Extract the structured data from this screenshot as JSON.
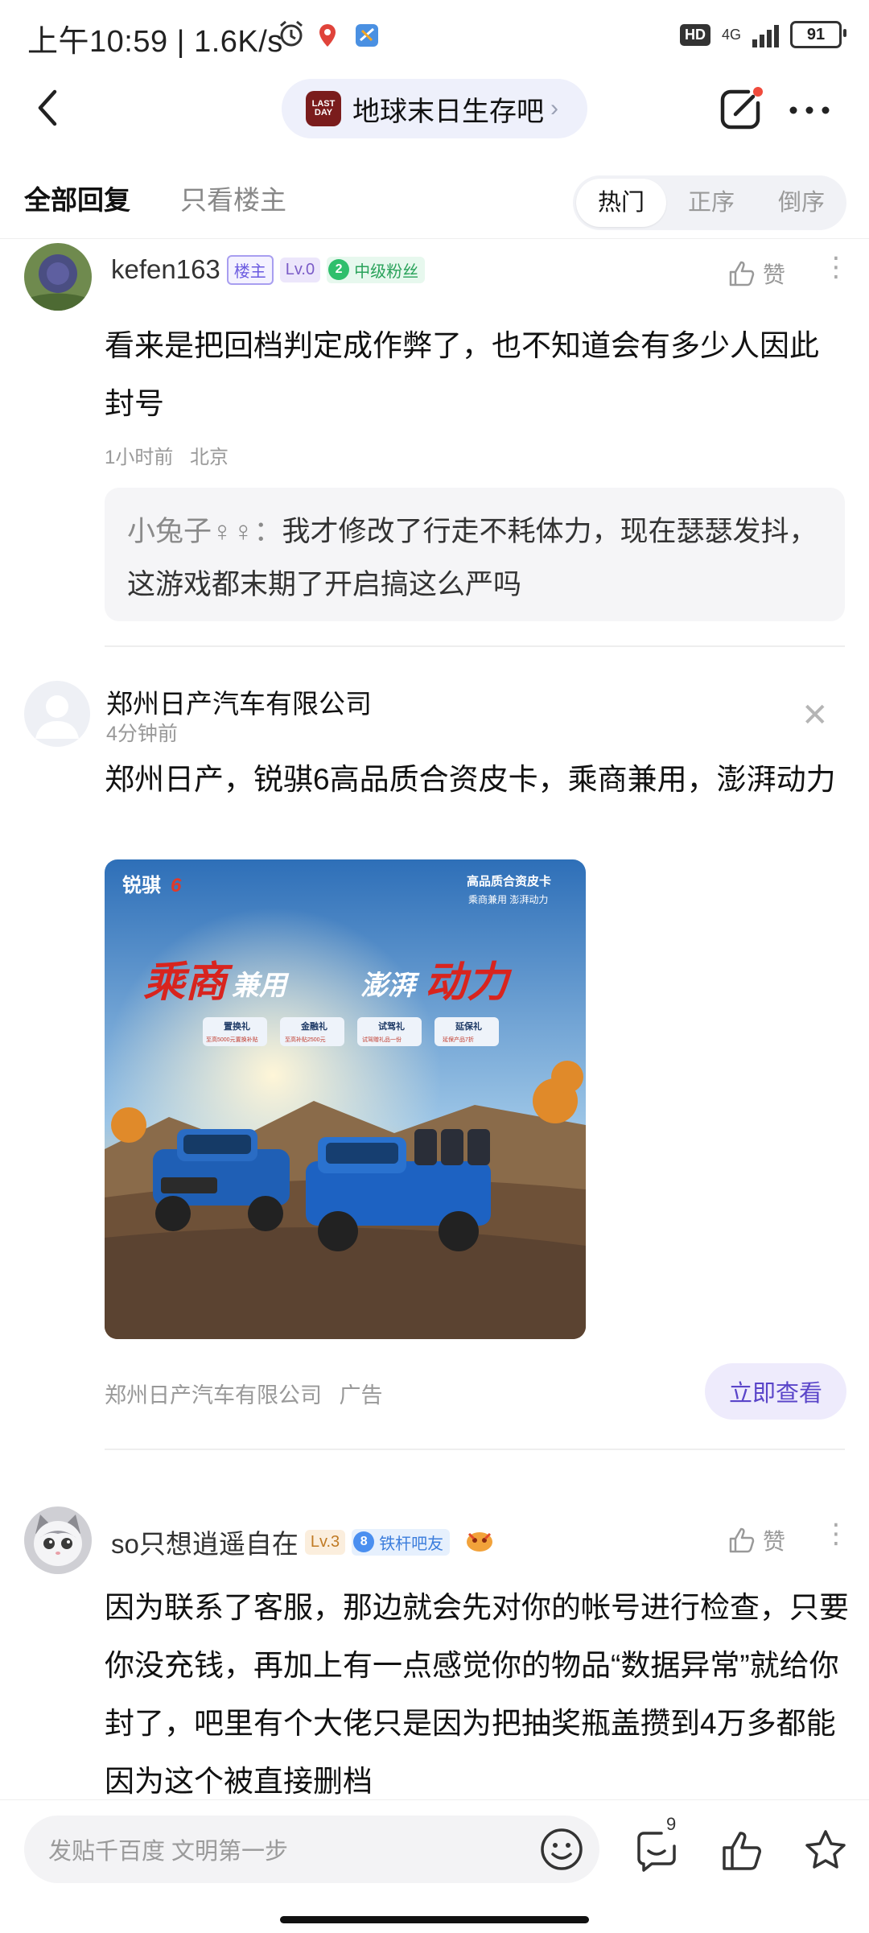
{
  "status_bar": {
    "time": "上午10:59 | 1.6K/s",
    "hd": "HD",
    "network": "4G",
    "battery": "91"
  },
  "nav": {
    "forum_logo_text": "LAST DAY",
    "forum_name": "地球末日生存吧"
  },
  "tabs": {
    "all": "全部回复",
    "owner_only": "只看楼主",
    "sort": [
      "热门",
      "正序",
      "倒序"
    ]
  },
  "post1": {
    "username": "kefen163",
    "owner_tag": "楼主",
    "level": "Lv.0",
    "fan_level": "2",
    "fan_label": "中级粉丝",
    "like_label": "赞",
    "content": "看来是把回档判定成作弊了，也不知道会有多少人因此封号",
    "time": "1小时前",
    "location": "北京",
    "reply_user": "小兔子♀♀：",
    "reply_text": "我才修改了行走不耗体力，现在瑟瑟发抖，这游戏都末期了开启搞这么严吗"
  },
  "ad": {
    "title": "郑州日产汽车有限公司",
    "time": "4分钟前",
    "text": "郑州日产，锐骐6高品质合资皮卡，乘商兼用，澎湃动力",
    "image": {
      "brand": "锐骐",
      "brand_num": "6",
      "tagline1": "高品质合资皮卡",
      "tagline2": "乘商兼用   澎湃动力",
      "headline_a": "乘商",
      "headline_b": "兼用",
      "headline_c": "澎湃",
      "headline_d": "动力",
      "chips": [
        "置换礼",
        "金融礼",
        "试驾礼",
        "延保礼"
      ],
      "chip_subs": [
        "至高5000元置换补贴",
        "至高补贴2500元",
        "试驾赠礼品一份",
        "延保产品7折"
      ]
    },
    "advertiser": "郑州日产汽车有限公司",
    "ad_label": "广告",
    "cta": "立即查看"
  },
  "post2": {
    "username": "so只想逍遥自在",
    "level": "Lv.3",
    "fan_level": "8",
    "fan_label": "铁杆吧友",
    "like_label": "赞",
    "content": "因为联系了客服，那边就会先对你的帐号进行检查，只要你没充钱，再加上有一点感觉你的物品“数据异常”就给你封了，吧里有个大佬只是因为把抽奖瓶盖攒到4万多都能因为这个被直接删档"
  },
  "bottom": {
    "placeholder": "发贴千百度 文明第一步",
    "reply_count": "9"
  }
}
